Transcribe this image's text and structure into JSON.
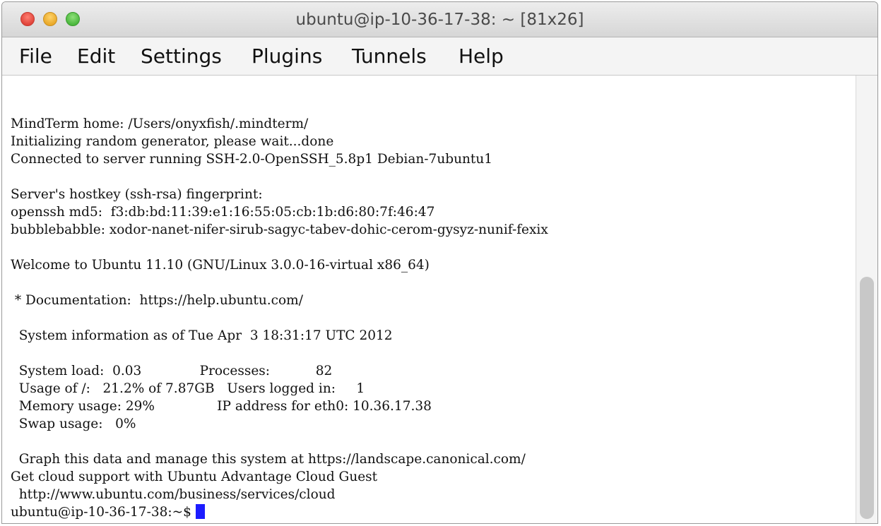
{
  "window": {
    "title": "ubuntu@ip-10-36-17-38: ~ [81x26]"
  },
  "menu": {
    "items": [
      {
        "label": "File"
      },
      {
        "label": "Edit"
      },
      {
        "label": "Settings"
      },
      {
        "label": "Plugins"
      },
      {
        "label": "Tunnels"
      },
      {
        "label": "Help"
      }
    ]
  },
  "terminal": {
    "lines": [
      "MindTerm home: /Users/onyxfish/.mindterm/",
      "Initializing random generator, please wait...done",
      "Connected to server running SSH-2.0-OpenSSH_5.8p1 Debian-7ubuntu1",
      "",
      "Server's hostkey (ssh-rsa) fingerprint:",
      "openssh md5:  f3:db:bd:11:39:e1:16:55:05:cb:1b:d6:80:7f:46:47",
      "bubblebabble: xodor-nanet-nifer-sirub-sagyc-tabev-dohic-cerom-gysyz-nunif-fexix",
      "",
      "Welcome to Ubuntu 11.10 (GNU/Linux 3.0.0-16-virtual x86_64)",
      "",
      " * Documentation:  https://help.ubuntu.com/",
      "",
      "  System information as of Tue Apr  3 18:31:17 UTC 2012",
      "",
      "  System load:  0.03              Processes:           82",
      "  Usage of /:   21.2% of 7.87GB   Users logged in:     1",
      "  Memory usage: 29%               IP address for eth0: 10.36.17.38",
      "  Swap usage:   0%",
      "",
      "  Graph this data and manage this system at https://landscape.canonical.com/",
      "Get cloud support with Ubuntu Advantage Cloud Guest",
      "  http://www.ubuntu.com/business/services/cloud"
    ],
    "prompt": "ubuntu@ip-10-36-17-38:~$"
  },
  "colors": {
    "cursor": "#1c1cff",
    "text": "#111111",
    "close": "#e0443a",
    "minimize": "#e9a92a",
    "maximize": "#4cb83e"
  }
}
